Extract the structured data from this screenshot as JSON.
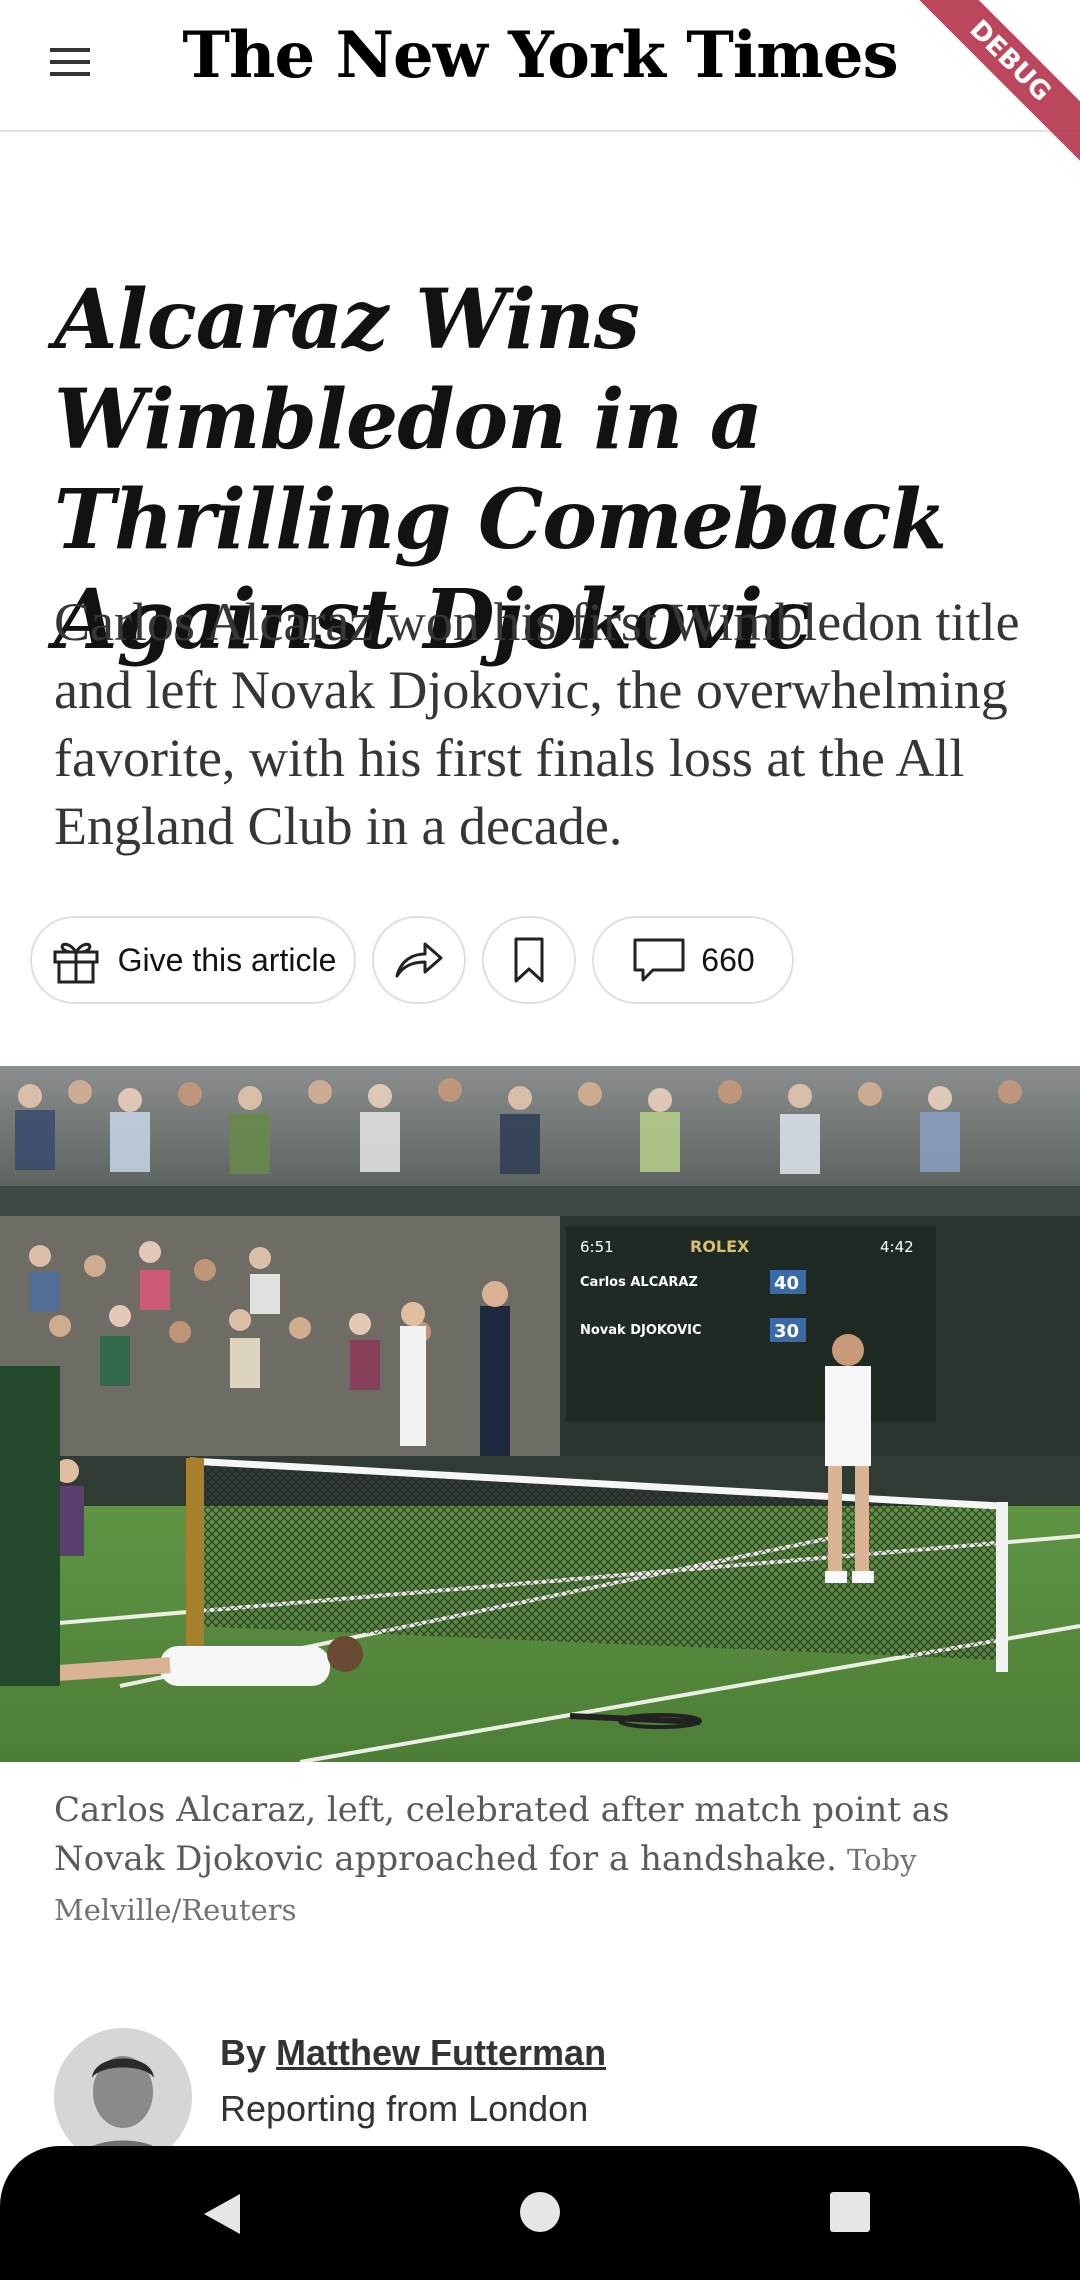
{
  "app": {
    "logo_text": "The New York Times",
    "debug_banner": "DEBUG"
  },
  "article": {
    "headline": "Alcaraz Wins Wimbledon in a Thrilling Comeback Against Djokovic",
    "summary": "Carlos Alcaraz won his first Wimbledon title and left Novak Djokovic, the overwhelming favorite, with his first finals loss at the All England Club in a decade.",
    "actions": {
      "gift_label": "Give this article",
      "comment_count": "660",
      "icons": [
        "gift-icon",
        "share-icon",
        "bookmark-icon",
        "comment-icon"
      ]
    },
    "photo": {
      "scoreboard_brand": "ROLEX",
      "scoreboard_time_left": "6:51",
      "scoreboard_time_right": "4:42",
      "player1": "Carlos ALCARAZ",
      "player2": "Novak DJOKOVIC",
      "score1": "40",
      "score2": "30"
    },
    "caption": "Carlos Alcaraz, left, celebrated after match point as Novak Djokovic approached for a handshake.",
    "credit": "Toby Melville/Reuters",
    "byline": {
      "prefix": "By",
      "author": "Matthew Futterman",
      "dateline": "Reporting from London"
    }
  },
  "colors": {
    "ribbon": "#b5344c",
    "grass": "#4f8a3a",
    "scoreboard": "#1f2a22"
  }
}
